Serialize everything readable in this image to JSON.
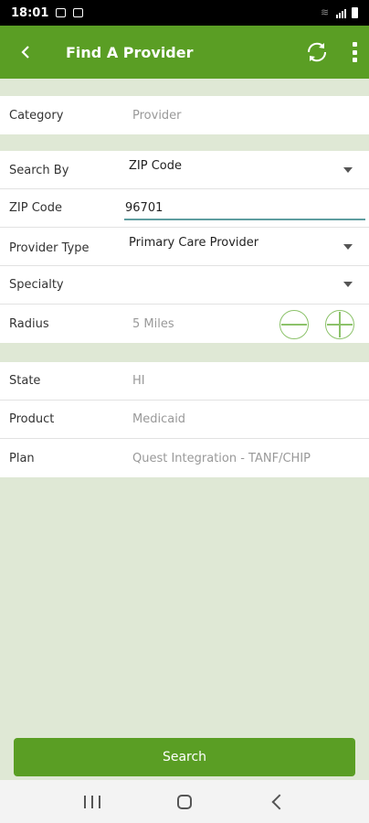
{
  "status_bar": {
    "time": "18:01"
  },
  "app_bar": {
    "title": "Find A Provider",
    "back_icon": "‹"
  },
  "section1": {
    "category_label": "Category",
    "category_value": "Provider"
  },
  "section2": {
    "search_by_label": "Search By",
    "search_by_value": "ZIP Code",
    "zip_label": "ZIP Code",
    "zip_value": "96701",
    "provider_type_label": "Provider Type",
    "provider_type_value": "Primary Care Provider",
    "specialty_label": "Specialty",
    "specialty_value": "",
    "radius_label": "Radius",
    "radius_value": "5 Miles"
  },
  "section3": {
    "state_label": "State",
    "state_value": "HI",
    "product_label": "Product",
    "product_value": "Medicaid",
    "plan_label": "Plan",
    "plan_value": "Quest Integration - TANF/CHIP"
  },
  "search_button": {
    "label": "Search"
  },
  "colors": {
    "brand_green": "#5a9e24",
    "background": "#dfe8d5",
    "input_underline": "#5f9ea0"
  },
  "icons": [
    "back-arrow-icon",
    "refresh-icon",
    "more-vert-icon",
    "minus-circle-icon",
    "plus-circle-icon",
    "dropdown-caret-icon"
  ]
}
